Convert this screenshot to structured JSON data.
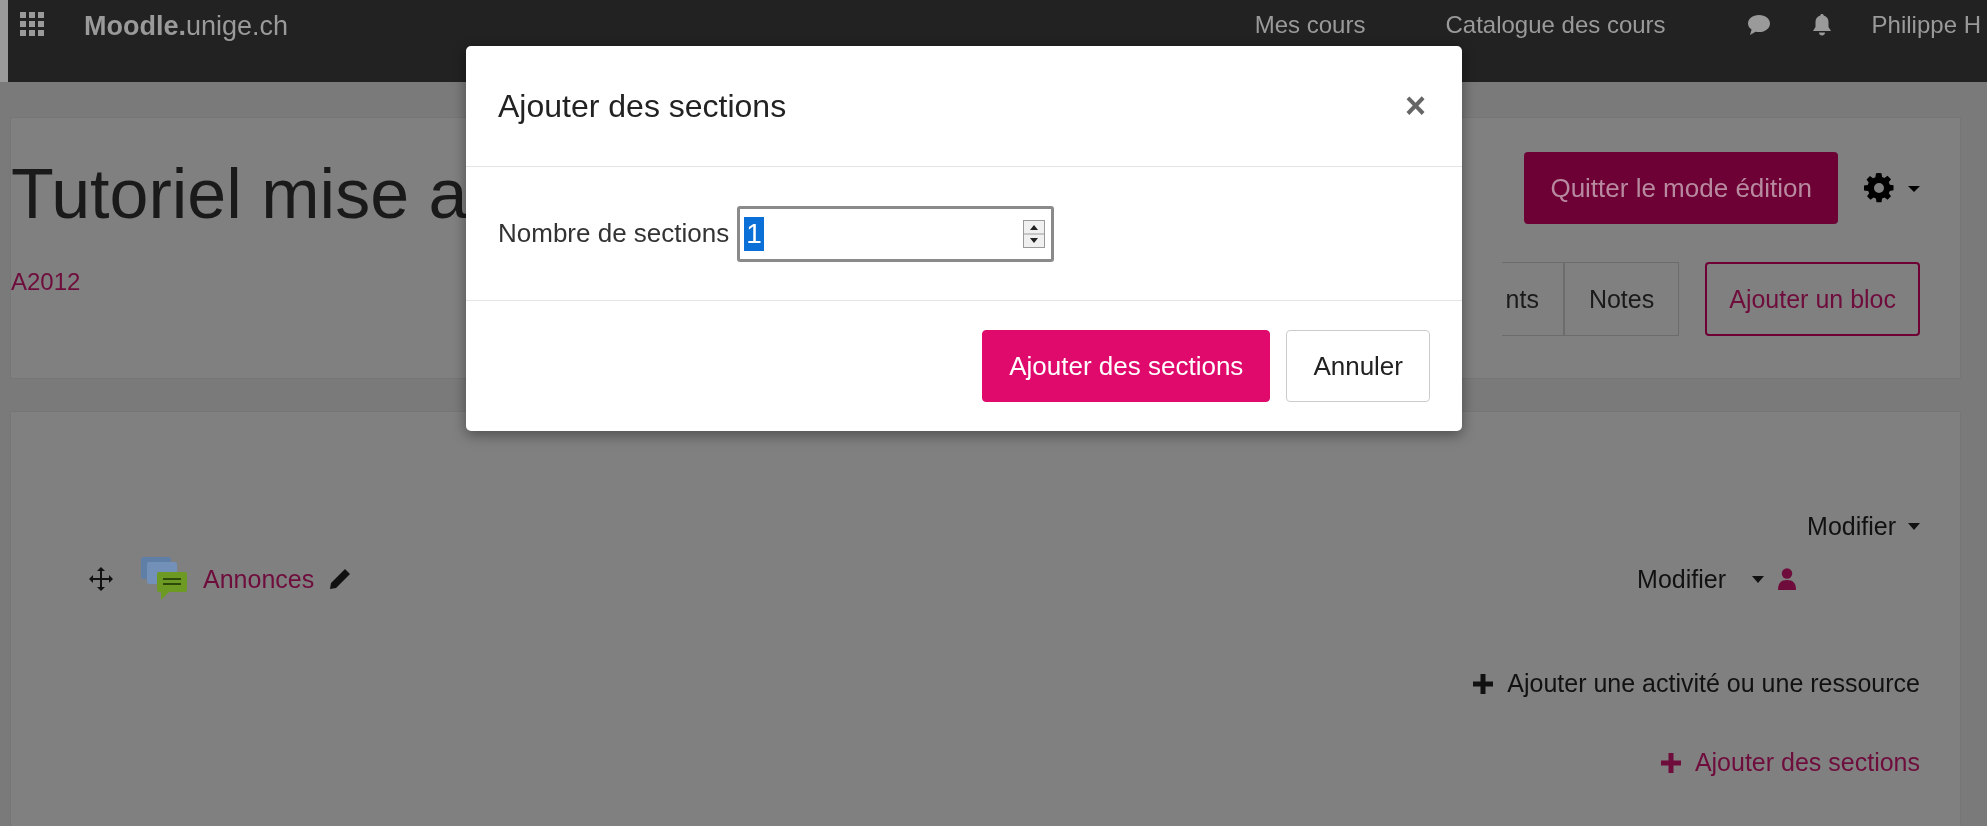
{
  "navbar": {
    "brand": "**Moodle.**unige.ch",
    "links": [
      "Mes cours",
      "Catalogue des cours"
    ],
    "user": "Philippe H"
  },
  "header": {
    "title": "Tutoriel mise a",
    "course_code": "A2012",
    "edit_button": "Quitter le mode édition",
    "buttons": [
      {
        "label": "nts"
      },
      {
        "label": "Notes"
      }
    ],
    "add_block": "Ajouter un bloc"
  },
  "section": {
    "menu": "Modifier",
    "activity": {
      "name": "Annonces",
      "menu": "Modifier"
    },
    "actions": [
      {
        "label": "Ajouter une activité ou une ressource",
        "kind": "plain"
      },
      {
        "label": "Ajouter des sections",
        "kind": "link"
      }
    ]
  },
  "modal": {
    "title": "Ajouter des sections",
    "close": "×",
    "field": {
      "label": "Nombre de sections",
      "value": "1",
      "value_selected": true
    },
    "buttons": [
      {
        "label": "Ajouter des sections",
        "kind": "primary"
      },
      {
        "label": "Annuler",
        "kind": "secondary"
      }
    ]
  }
}
